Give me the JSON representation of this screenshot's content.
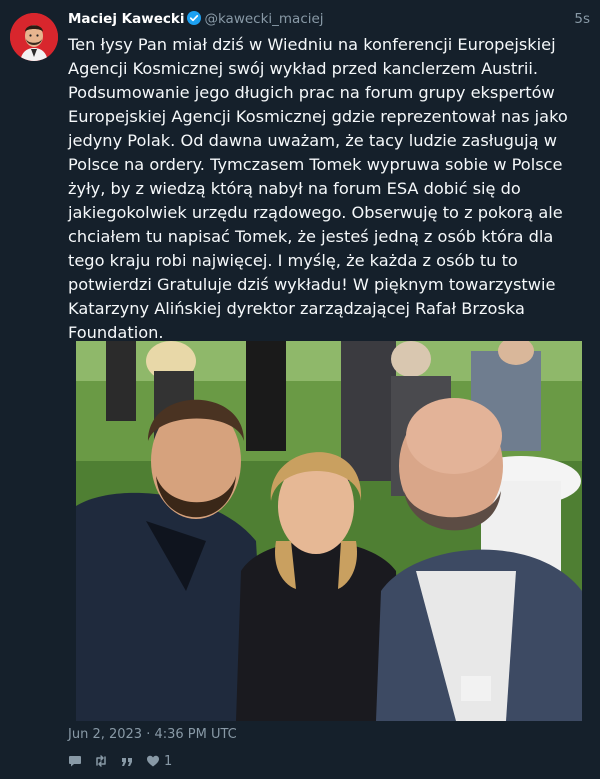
{
  "tweet": {
    "author_name": "Maciej Kawecki",
    "handle": "@kawecki_maciej",
    "relative_time": "5s",
    "text": "Ten łysy Pan miał dziś w Wiedniu na konferencji Europejskiej Agencji Kosmicznej swój wykład przed kanclerzem Austrii. Podsumowanie jego długich prac na forum grupy ekspertów Europejskiej Agencji Kosmicznej gdzie reprezentował nas jako jedyny Polak. Od dawna uważam, że tacy ludzie zasługują w Polsce na ordery. Tymczasem Tomek wypruwa sobie w Polsce żyły, by z wiedzą którą nabył na forum ESA dobić się do jakiegokolwiek urzędu rządowego. Obserwuję to z pokorą ale chciałem tu napisać Tomek, że jesteś jedną z osób która dla tego kraju robi najwięcej. I myślę, że każda z osób tu to potwierdzi     Gratuluje dziś wykładu! W pięknym towarzystwie Katarzyny Alińskiej dyrektor zarządzającej Rafał Brzoska Foundation.",
    "date": "Jun 2, 2023 · 4:36 PM UTC",
    "like_count": "1"
  },
  "icons": {
    "verified": "verified-badge-icon",
    "reply": "reply-icon",
    "retweet": "retweet-icon",
    "quote": "quote-icon",
    "like": "heart-icon"
  },
  "colors": {
    "background": "#15202b",
    "secondary_text": "#8899a6",
    "verified_blue": "#1da1f2",
    "avatar_red": "#d8262d"
  }
}
